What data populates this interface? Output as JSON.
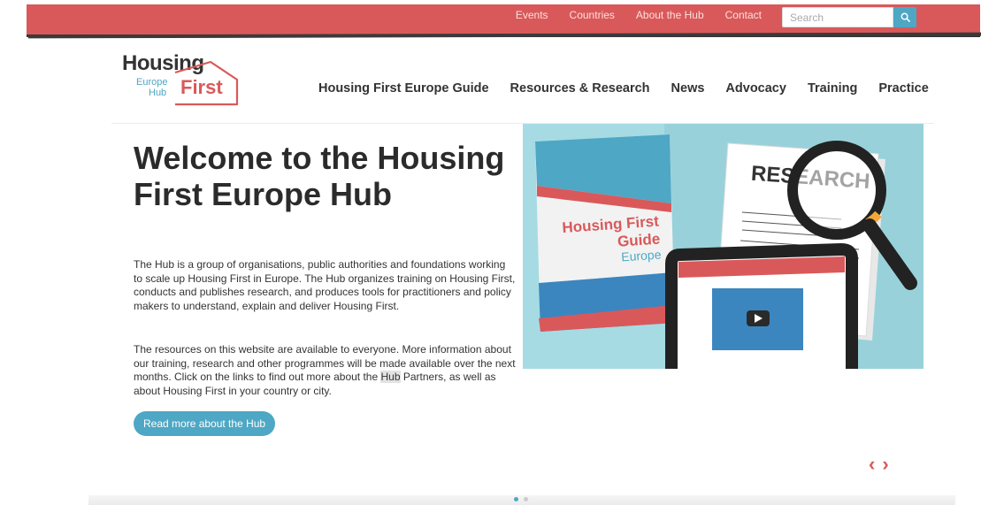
{
  "topbar": {
    "links": [
      "Events",
      "Countries",
      "About the Hub",
      "Contact"
    ],
    "search_placeholder": "Search"
  },
  "logo": {
    "line1": "Housing",
    "line2a": "Europe",
    "line2b": "Hub",
    "line3": "First"
  },
  "nav": [
    "Housing First Europe Guide",
    "Resources & Research",
    "News",
    "Advocacy",
    "Training",
    "Practice"
  ],
  "hero": {
    "title": "Welcome to the Housing First Europe Hub",
    "p1": "The Hub is a group of organisations, public authorities and foundations working to scale up Housing First in Europe. The Hub organizes training on Housing First, conducts and publishes research, and produces tools for practitioners and policy makers to understand, explain and deliver Housing First.",
    "p2_before": "The resources on this website are available to everyone. More information about our training, research and other programmes will be made available over the next months. Click on the links to find out more about the ",
    "p2_highlight": "Hub",
    "p2_after": " Partners, as well as about Housing First in your country or city.",
    "cta": "Read more about the Hub"
  },
  "illustration": {
    "book_line1": "Housing First",
    "book_line2": "Guide",
    "book_line3": "Europe",
    "doc_word": "RESEARCH"
  },
  "carousel": {
    "prev": "‹",
    "next": "›",
    "slides": 2,
    "active": 1
  },
  "colors": {
    "brand_red": "#d9595a",
    "accent_blue": "#4ea7c4",
    "illustration_bg": "#a6dbe3"
  }
}
